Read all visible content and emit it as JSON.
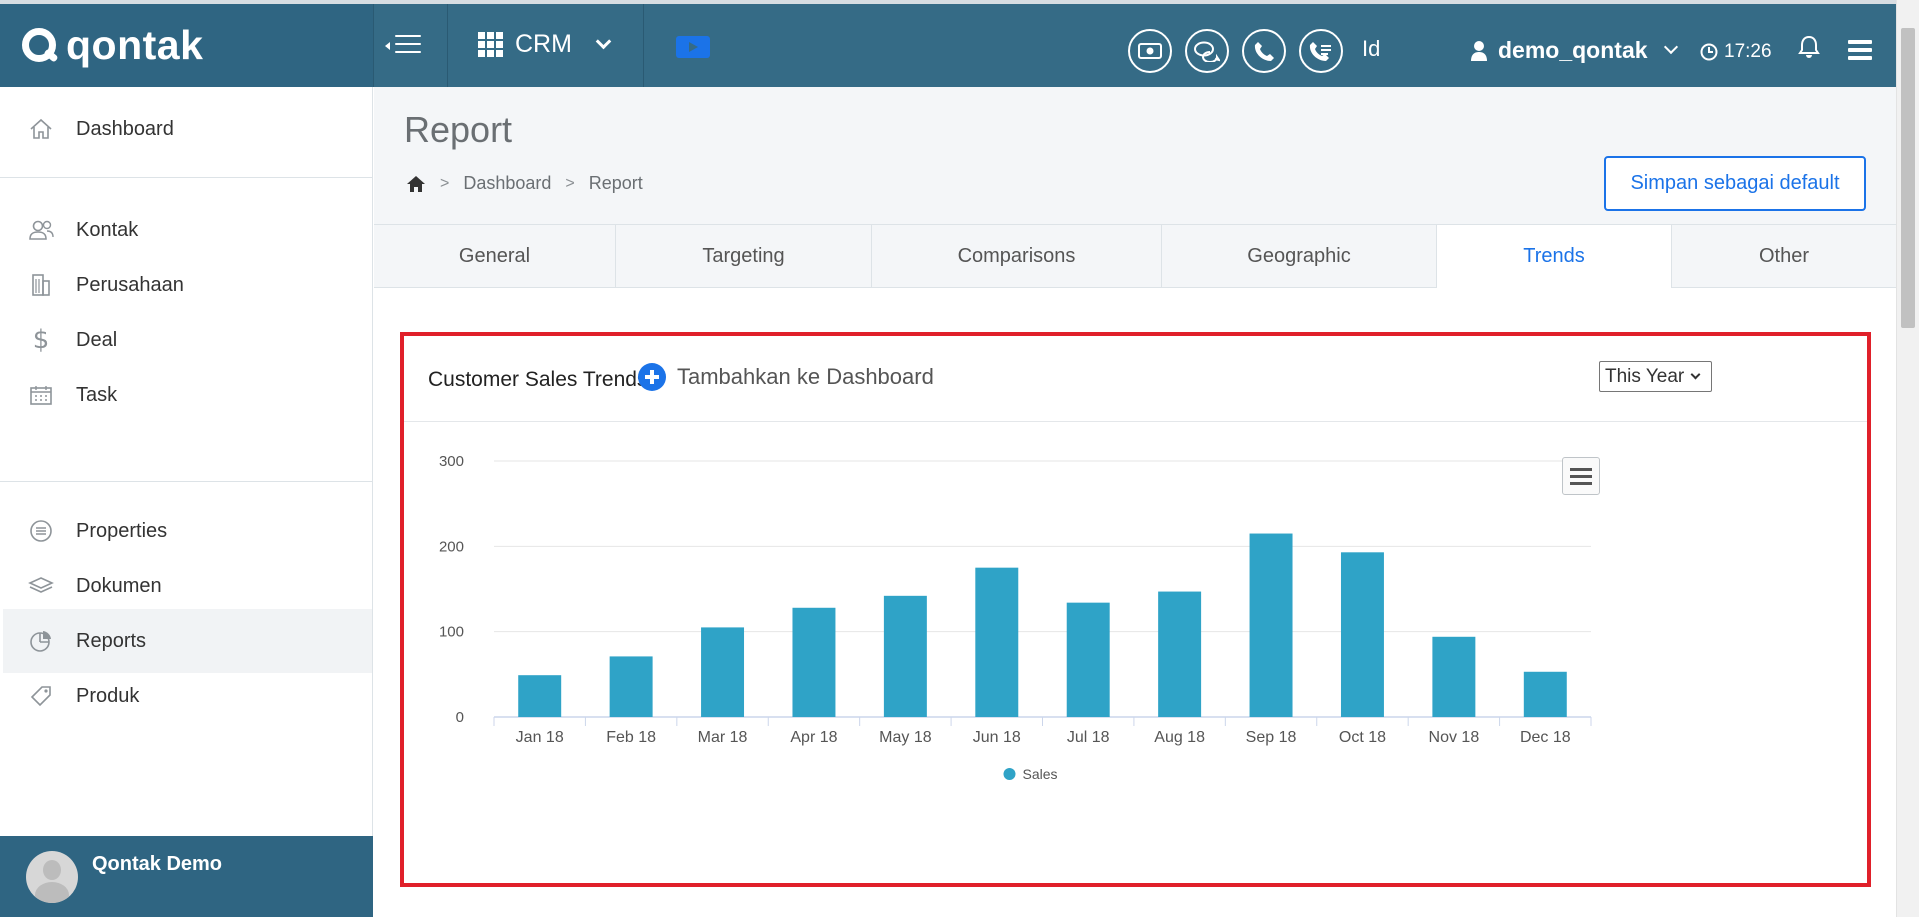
{
  "app": {
    "logo_text": "qontak"
  },
  "topbar": {
    "module_label": "CRM",
    "language": "Id",
    "user_name": "demo_qontak",
    "clock_time": "17:26",
    "icons": [
      "money-icon",
      "chat-icon",
      "phone-icon",
      "call-log-icon",
      "bell-icon",
      "menu-icon"
    ]
  },
  "sidebar": {
    "items": [
      {
        "label": "Dashboard",
        "icon": "home-icon"
      },
      {
        "label": "Kontak",
        "icon": "contacts-icon"
      },
      {
        "label": "Perusahaan",
        "icon": "building-icon"
      },
      {
        "label": "Deal",
        "icon": "dollar-icon"
      },
      {
        "label": "Task",
        "icon": "calendar-icon"
      },
      {
        "label": "Properties",
        "icon": "list-icon"
      },
      {
        "label": "Dokumen",
        "icon": "layers-icon"
      },
      {
        "label": "Reports",
        "icon": "pie-chart-icon",
        "active": true
      },
      {
        "label": "Produk",
        "icon": "tag-icon"
      }
    ],
    "profile_name": "Qontak Demo"
  },
  "page": {
    "title": "Report",
    "breadcrumb": [
      "Dashboard",
      "Report"
    ],
    "save_default_label": "Simpan sebagai default"
  },
  "tabs": [
    {
      "label": "General"
    },
    {
      "label": "Targeting"
    },
    {
      "label": "Comparisons"
    },
    {
      "label": "Geographic"
    },
    {
      "label": "Trends",
      "active": true
    },
    {
      "label": "Other"
    }
  ],
  "card": {
    "title": "Customer Sales Trends",
    "add_dashboard_label": "Tambahkan ke Dashboard",
    "period_selected": "This Year"
  },
  "colors": {
    "topbar": "#356b86",
    "accent": "#1b73e8",
    "bar": "#2fa3c7",
    "highlight_border": "#e0202a"
  },
  "chart_data": {
    "type": "bar",
    "categories": [
      "Jan 18",
      "Feb 18",
      "Mar 18",
      "Apr 18",
      "May 18",
      "Jun 18",
      "Jul 18",
      "Aug 18",
      "Sep 18",
      "Oct 18",
      "Nov 18",
      "Dec 18"
    ],
    "series": [
      {
        "name": "Sales",
        "values": [
          49,
          71,
          105,
          128,
          142,
          175,
          134,
          147,
          215,
          193,
          94,
          53
        ]
      }
    ],
    "yticks": [
      0,
      100,
      200,
      300
    ],
    "ylim": [
      0,
      300
    ],
    "grid": true,
    "legend": "bottom-center"
  }
}
